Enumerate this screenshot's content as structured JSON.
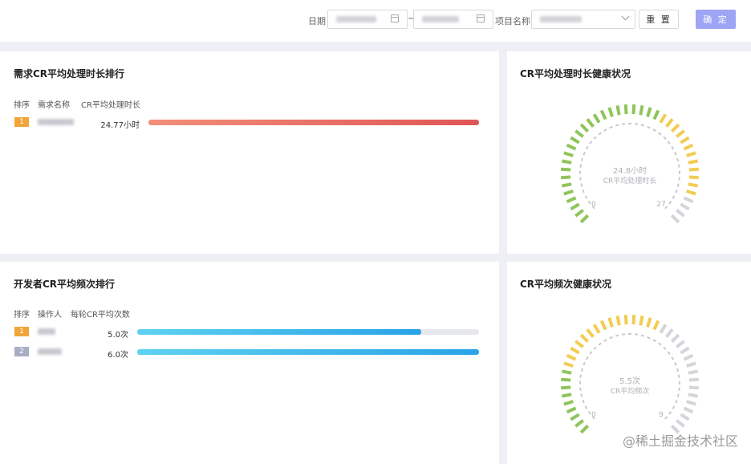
{
  "filters": {
    "date_label": "日期",
    "range_sep": "~",
    "project_label": "项目名称",
    "reset_label": "重 置",
    "ok_label": "确 定"
  },
  "panels": {
    "cr_duration_rank": {
      "title": "需求CR平均处理时长排行",
      "columns": [
        "排序",
        "需求名称",
        "CR平均处理时长"
      ],
      "rows": [
        {
          "rank": "1",
          "value": "24.77小时",
          "fill": 1.0
        }
      ]
    },
    "cr_duration_health": {
      "title": "CR平均处理时长健康状况",
      "center_value": "24.8小时",
      "center_label": "CR平均处理时长",
      "min_label": "0",
      "max_label": "27",
      "value": 24.8,
      "max": 27
    },
    "dev_freq_rank": {
      "title": "开发者CR平均频次排行",
      "columns": [
        "排序",
        "操作人",
        "每轮CR平均次数"
      ],
      "rows": [
        {
          "rank": "1",
          "value": "5.0次",
          "fill": 0.83
        },
        {
          "rank": "2",
          "value": "6.0次",
          "fill": 1.0
        }
      ]
    },
    "freq_health": {
      "title": "CR平均频次健康状况",
      "center_value": "5.5次",
      "center_label": "CR平均频次",
      "min_label": "0",
      "max_label": "9",
      "value": 5.5,
      "max": 9
    }
  },
  "colors": {
    "accent": "#9ea5f5",
    "green": "#8fc55a",
    "yellow": "#f3cc52",
    "gray": "#d4d4da"
  },
  "watermark": "@稀土掘金技术社区"
}
